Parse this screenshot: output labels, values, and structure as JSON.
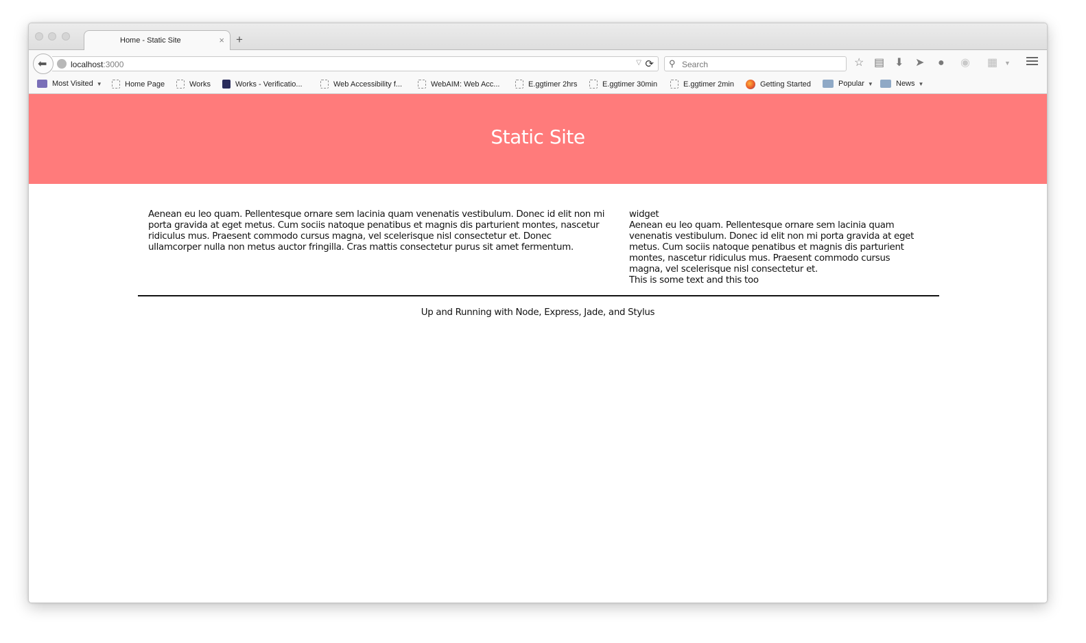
{
  "browser": {
    "tab_title": "Home - Static Site",
    "tab_close": "×",
    "new_tab": "+",
    "url_host": "localhost",
    "url_port": ":3000",
    "search_placeholder": "Search",
    "icons": [
      "back-icon",
      "globe-icon",
      "reload-icon",
      "search-icon",
      "star-icon",
      "reading-list-icon",
      "download-icon",
      "share-icon",
      "chat-icon",
      "pocket-icon",
      "grid-icon",
      "menu-icon"
    ]
  },
  "bookmarks": [
    {
      "label": "Most Visited",
      "icon": "mv",
      "dropdown": true
    },
    {
      "label": "Home Page",
      "icon": "page"
    },
    {
      "label": "Works",
      "icon": "page"
    },
    {
      "label": "Works - Verificatio...",
      "icon": "solid"
    },
    {
      "label": "Web Accessibility f...",
      "icon": "page"
    },
    {
      "label": "WebAIM: Web Acc...",
      "icon": "page"
    },
    {
      "label": "E.ggtimer 2hrs",
      "icon": "page"
    },
    {
      "label": "E.ggtimer 30min",
      "icon": "page"
    },
    {
      "label": "E.ggtimer 2min",
      "icon": "page"
    },
    {
      "label": "Getting Started",
      "icon": "ff"
    },
    {
      "label": "Popular",
      "icon": "folder",
      "dropdown": true
    },
    {
      "label": "News",
      "icon": "folder",
      "dropdown": true
    }
  ],
  "site": {
    "title": "Static Site",
    "header_color": "#ff7b7b",
    "main_text": "Aenean eu leo quam. Pellentesque ornare sem lacinia quam venenatis vestibulum. Donec id elit non mi porta gravida at eget metus. Cum sociis natoque penatibus et magnis dis parturient montes, nascetur ridiculus mus. Praesent commodo cursus magna, vel scelerisque nisl consectetur et. Donec ullamcorper nulla non metus auctor fringilla. Cras mattis consectetur purus sit amet fermentum.",
    "widget_title": "widget",
    "widget_text": "Aenean eu leo quam. Pellentesque ornare sem lacinia quam venenatis vestibulum. Donec id elit non mi porta gravida at eget metus. Cum sociis natoque penatibus et magnis dis parturient montes, nascetur ridiculus mus. Praesent commodo cursus magna, vel scelerisque nisl consectetur et.",
    "widget_extra": "This is some text and this too",
    "footer": "Up and Running with Node, Express, Jade, and Stylus"
  }
}
